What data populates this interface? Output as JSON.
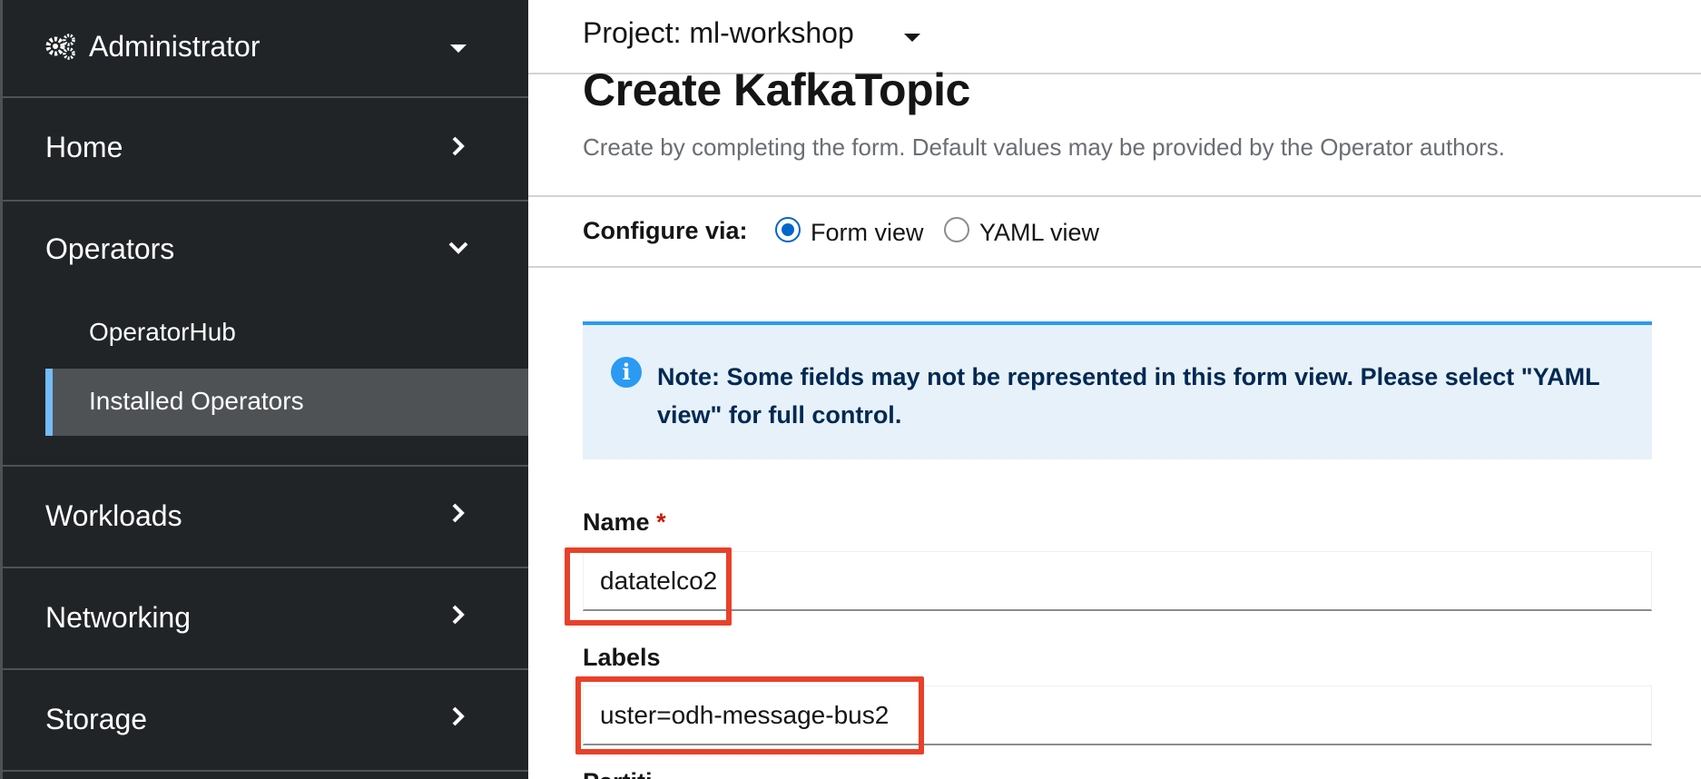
{
  "sidebar": {
    "perspective": {
      "label": "Administrator",
      "icon": "gears-icon",
      "chevron": "caret-down-icon"
    },
    "sections": [
      {
        "label": "Home",
        "expanded": false
      },
      {
        "label": "Operators",
        "expanded": true,
        "items": [
          "OperatorHub",
          "Installed Operators"
        ],
        "active_item": "Installed Operators"
      },
      {
        "label": "Workloads",
        "expanded": false
      },
      {
        "label": "Networking",
        "expanded": false
      },
      {
        "label": "Storage",
        "expanded": false
      }
    ]
  },
  "header": {
    "project": "Project: ml-workshop"
  },
  "page": {
    "title": "Create KafkaTopic",
    "description": "Create by completing the form. Default values may be provided by the Operator authors."
  },
  "configure": {
    "label": "Configure via:",
    "options": [
      "Form view",
      "YAML view"
    ],
    "selected": "Form view"
  },
  "alert": {
    "text": "Note: Some fields may not be represented in this form view. Please select \"YAML view\" for full control."
  },
  "form": {
    "name_label": "Name",
    "required_mark": "*",
    "name_value": "datatelco2",
    "labels_label": "Labels",
    "labels_value": "uster=odh-message-bus2",
    "next_label_partial": "Partiti"
  },
  "colors": {
    "sidebar_bg": "#212427",
    "active_bg": "#4f5255",
    "active_accent": "#73bcf7",
    "primary_blue": "#0066cc",
    "alert_bg": "#e7f1fa",
    "annotation_red": "#e8412a"
  }
}
